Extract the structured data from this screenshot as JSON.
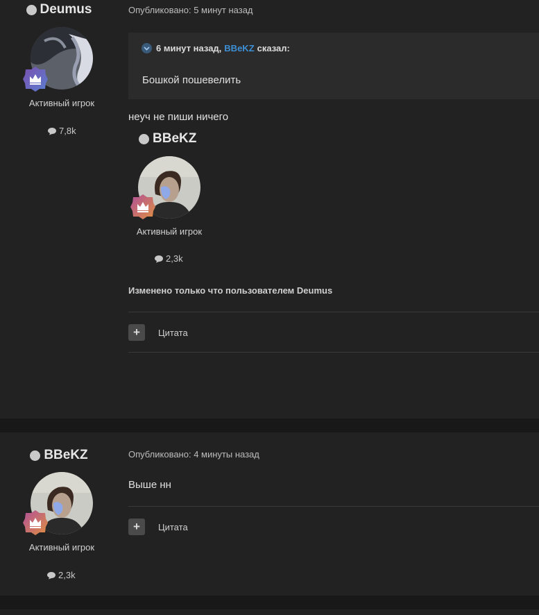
{
  "posts": [
    {
      "author": {
        "name": "Deumus",
        "role": "Активный игрок",
        "posts_count": "7,8k",
        "status_icon": "offline-dot-icon",
        "badge_icon": "crown-icon"
      },
      "published": "Опубликовано: 5 минут назад",
      "quote": {
        "time": "6 минут назад,",
        "author": "BBeKZ",
        "said": "сказал:",
        "text": "Бошкой пошевелить"
      },
      "text": "неуч не пиши ничего",
      "signature": {
        "name": "BBeKZ",
        "role": "Активный игрок",
        "posts_count": "2,3k"
      },
      "edited": "Изменено только что пользователем Deumus",
      "quote_button": "Цитата"
    },
    {
      "author": {
        "name": "BBeKZ",
        "role": "Активный игрок",
        "posts_count": "2,3k",
        "status_icon": "offline-dot-icon",
        "badge_icon": "crown-icon"
      },
      "published": "Опубликовано: 4 минуты назад",
      "text": "Выше нн",
      "quote_button": "Цитата"
    }
  ],
  "colors": {
    "page_bg": "#181818",
    "post_bg": "#222222",
    "quote_bg": "#2b2b2b",
    "link": "#3d8fd6",
    "badge_purple": "#7b4fb0",
    "badge_orange": "#d98a3a"
  }
}
